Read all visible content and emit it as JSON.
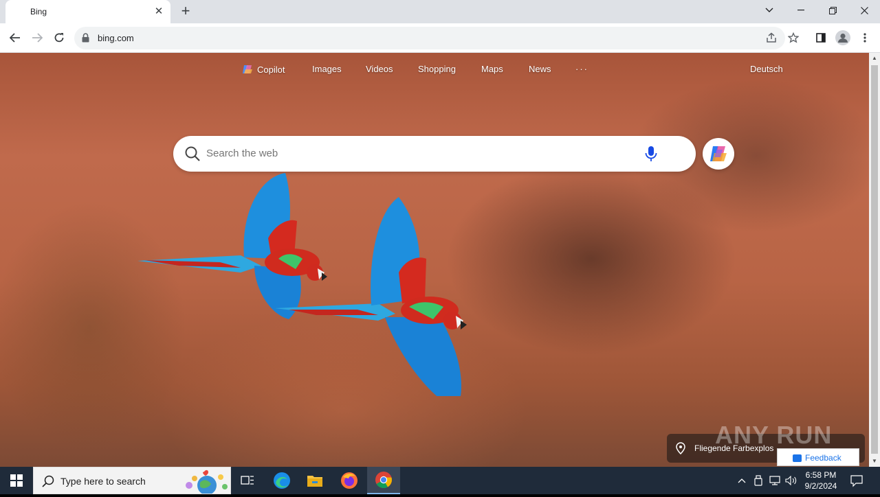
{
  "browser": {
    "tab": {
      "title": "Bing",
      "close_icon": "close-icon"
    },
    "new_tab_icon": "plus-icon",
    "window_controls": [
      "chevron-down-icon",
      "minimize-icon",
      "restore-icon",
      "close-icon"
    ],
    "address": "bing.com",
    "toolbar_icons": [
      "back-icon",
      "forward-icon",
      "reload-icon",
      "lock-icon",
      "share-icon",
      "star-icon",
      "side-panel-icon",
      "profile-icon",
      "menu-icon"
    ]
  },
  "bing": {
    "nav": [
      {
        "label": "Copilot",
        "icon": "copilot-icon"
      },
      {
        "label": "Images"
      },
      {
        "label": "Videos"
      },
      {
        "label": "Shopping"
      },
      {
        "label": "Maps"
      },
      {
        "label": "News"
      },
      {
        "label": "···"
      }
    ],
    "language": "Deutsch",
    "search_placeholder": "Search the web",
    "location_caption": "Fliegende Farbexplos",
    "watermark": "ANY RUN",
    "feedback": "Feedback",
    "colors": {
      "background": "#b8613f",
      "accent": "#1a73e8"
    }
  },
  "taskbar": {
    "search_placeholder": "Type here to search",
    "apps": [
      "task-view-icon",
      "edge-icon",
      "file-explorer-icon",
      "firefox-icon",
      "chrome-icon"
    ],
    "tray": [
      "chevron-up-icon",
      "usb-icon",
      "network-icon",
      "volume-icon"
    ],
    "time": "6:58 PM",
    "date": "9/2/2024"
  }
}
